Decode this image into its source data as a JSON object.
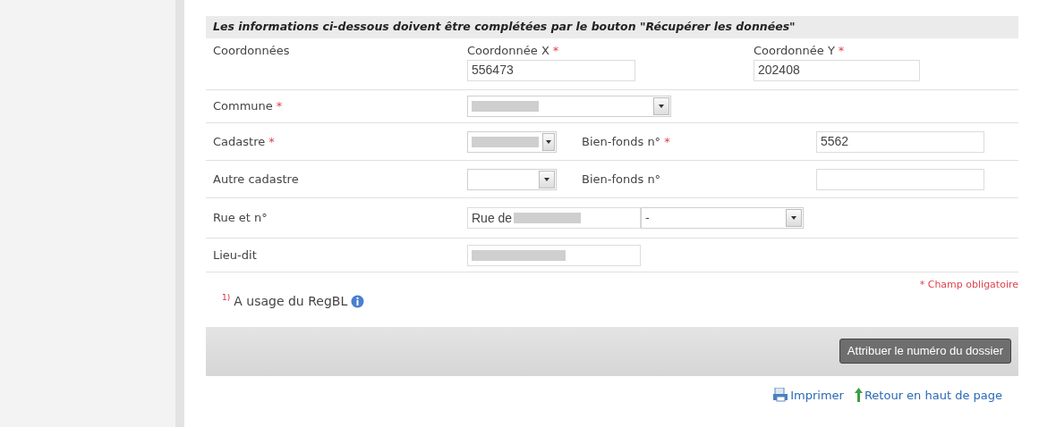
{
  "section_header": "Les informations ci-dessous doivent être complétées par le bouton \"Récupérer les données\"",
  "coordinates": {
    "label": "Coordonnées",
    "x": {
      "label": "Coordonnée X",
      "required_mark": "*",
      "value": "556473"
    },
    "y": {
      "label": "Coordonnée Y",
      "required_mark": "*",
      "value": "202408"
    }
  },
  "commune": {
    "label": "Commune",
    "required_mark": "*",
    "select": {
      "redacted": true
    }
  },
  "parcels": [
    {
      "label": "Cadastre",
      "required_mark": "*",
      "select": {
        "redacted": true
      },
      "plot_label": "Bien-fonds n°",
      "plot_required_mark": "*",
      "plot_value": "5562"
    },
    {
      "label": "Autre cadastre",
      "select": {
        "redacted": false
      },
      "plot_label": "Bien-fonds n°"
    }
  ],
  "street": {
    "label": "Rue et n°",
    "value": "Rue de",
    "redacted": true,
    "number_select": "-"
  },
  "locality": {
    "label": "Lieu-dit",
    "redacted": true
  },
  "required_note": "* Champ obligatoire",
  "footnote": {
    "mark": "1)",
    "text": "A usage du RegBL"
  },
  "assign_button": "Attribuer le numéro du dossier",
  "links": [
    {
      "kind": "print",
      "label": "Imprimer"
    },
    {
      "kind": "top",
      "label": "Retour en haut de page"
    }
  ]
}
